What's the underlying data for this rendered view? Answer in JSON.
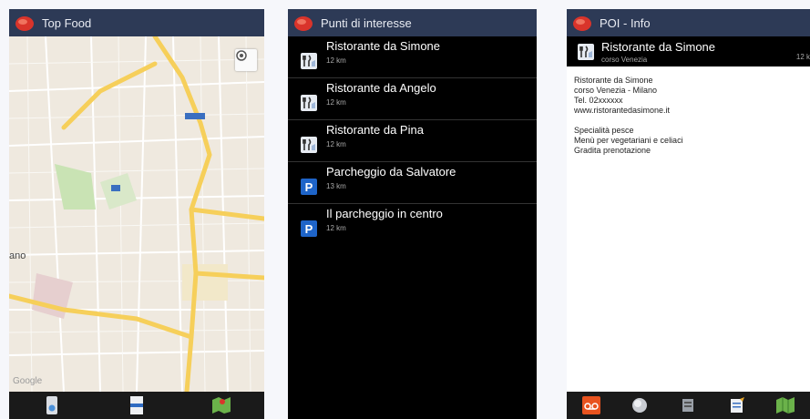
{
  "screen1": {
    "title": "Top Food",
    "map_label": "ano",
    "google_label": "Google"
  },
  "screen2": {
    "title": "Punti di interesse",
    "items": [
      {
        "name": "Ristorante da Simone",
        "distance": "12 km",
        "icon": "restaurant-icon"
      },
      {
        "name": "Ristorante da Angelo",
        "distance": "12 km",
        "icon": "restaurant-icon"
      },
      {
        "name": "Ristorante da Pina",
        "distance": "12 km",
        "icon": "restaurant-icon"
      },
      {
        "name": "Parcheggio da Salvatore",
        "distance": "13 km",
        "icon": "parking-icon"
      },
      {
        "name": "Il parcheggio in centro",
        "distance": "12 km",
        "icon": "parking-icon"
      }
    ]
  },
  "screen3": {
    "title": "POI - Info",
    "header_name": "Ristorante da Simone",
    "header_street": "corso Venezia",
    "header_distance": "12 k",
    "lines": [
      "Ristorante da Simone",
      "corso Venezia - Milano",
      "Tel. 02xxxxxx",
      "www.ristorantedasimone.it",
      "",
      "Specialità pesce",
      "Menù per vegetariani e celiaci",
      "Gradita prenotazione"
    ]
  },
  "colors": {
    "actionbar": "#2d3a56",
    "map_road_major": "#f6cf5a",
    "parking_badge": "#1e64c8"
  }
}
